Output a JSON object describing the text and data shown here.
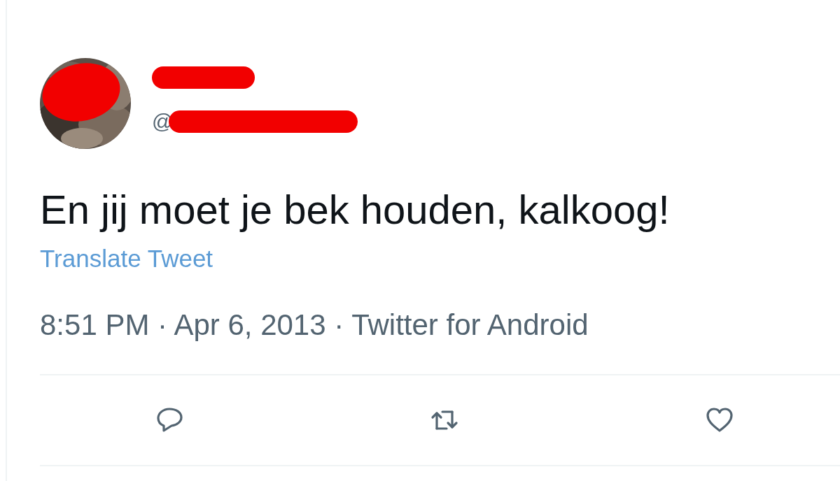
{
  "author": {
    "handle_prefix": "@"
  },
  "text": "En jij moet je bek houden, kalkoog!",
  "translate_link": "Translate Tweet",
  "meta": "8:51 PM · Apr 6, 2013 · Twitter for Android",
  "actions": [
    {
      "kind": "reply"
    },
    {
      "kind": "retweet"
    },
    {
      "kind": "like"
    }
  ]
}
